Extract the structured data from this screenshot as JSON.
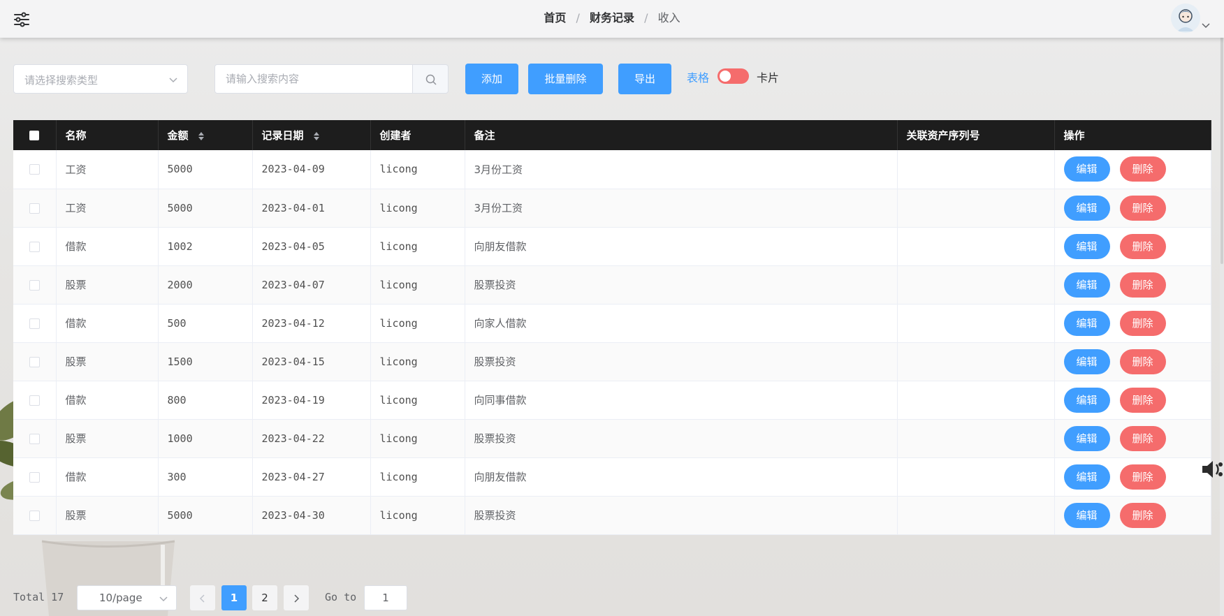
{
  "header": {
    "breadcrumb": [
      "首页",
      "财务记录",
      "收入"
    ],
    "separator": "/"
  },
  "toolbar": {
    "search_type_placeholder": "请选择搜索类型",
    "search_placeholder": "请输入搜索内容",
    "add_label": "添加",
    "batch_delete_label": "批量删除",
    "export_label": "导出",
    "view_table_label": "表格",
    "view_card_label": "卡片"
  },
  "table": {
    "columns": [
      "名称",
      "金额",
      "记录日期",
      "创建者",
      "备注",
      "关联资产序列号",
      "操作"
    ],
    "rows": [
      {
        "name": "工资",
        "amount": "5000",
        "date": "2023-04-09",
        "creator": "licong",
        "note": "3月份工资",
        "asset_serial": ""
      },
      {
        "name": "工资",
        "amount": "5000",
        "date": "2023-04-01",
        "creator": "licong",
        "note": "3月份工资",
        "asset_serial": ""
      },
      {
        "name": "借款",
        "amount": "1002",
        "date": "2023-04-05",
        "creator": "licong",
        "note": "向朋友借款",
        "asset_serial": ""
      },
      {
        "name": "股票",
        "amount": "2000",
        "date": "2023-04-07",
        "creator": "licong",
        "note": "股票投资",
        "asset_serial": ""
      },
      {
        "name": "借款",
        "amount": "500",
        "date": "2023-04-12",
        "creator": "licong",
        "note": "向家人借款",
        "asset_serial": ""
      },
      {
        "name": "股票",
        "amount": "1500",
        "date": "2023-04-15",
        "creator": "licong",
        "note": "股票投资",
        "asset_serial": ""
      },
      {
        "name": "借款",
        "amount": "800",
        "date": "2023-04-19",
        "creator": "licong",
        "note": "向同事借款",
        "asset_serial": ""
      },
      {
        "name": "股票",
        "amount": "1000",
        "date": "2023-04-22",
        "creator": "licong",
        "note": "股票投资",
        "asset_serial": ""
      },
      {
        "name": "借款",
        "amount": "300",
        "date": "2023-04-27",
        "creator": "licong",
        "note": "向朋友借款",
        "asset_serial": ""
      },
      {
        "name": "股票",
        "amount": "5000",
        "date": "2023-04-30",
        "creator": "licong",
        "note": "股票投资",
        "asset_serial": ""
      }
    ],
    "edit_label": "编辑",
    "delete_label": "删除"
  },
  "pagination": {
    "total_text": "Total 17",
    "page_size": "10/page",
    "pages": [
      "1",
      "2"
    ],
    "current_page": "1",
    "goto_label": "Go to",
    "goto_value": "1"
  },
  "colors": {
    "primary": "#409eff",
    "danger": "#f56c6c",
    "header_bg": "#1d1d1d"
  },
  "icons": {
    "menu": "sliders-icon",
    "search": "search-icon",
    "sort": "sort-icon",
    "speaker": "speaker-icon",
    "avatar": "avatar-icon"
  }
}
